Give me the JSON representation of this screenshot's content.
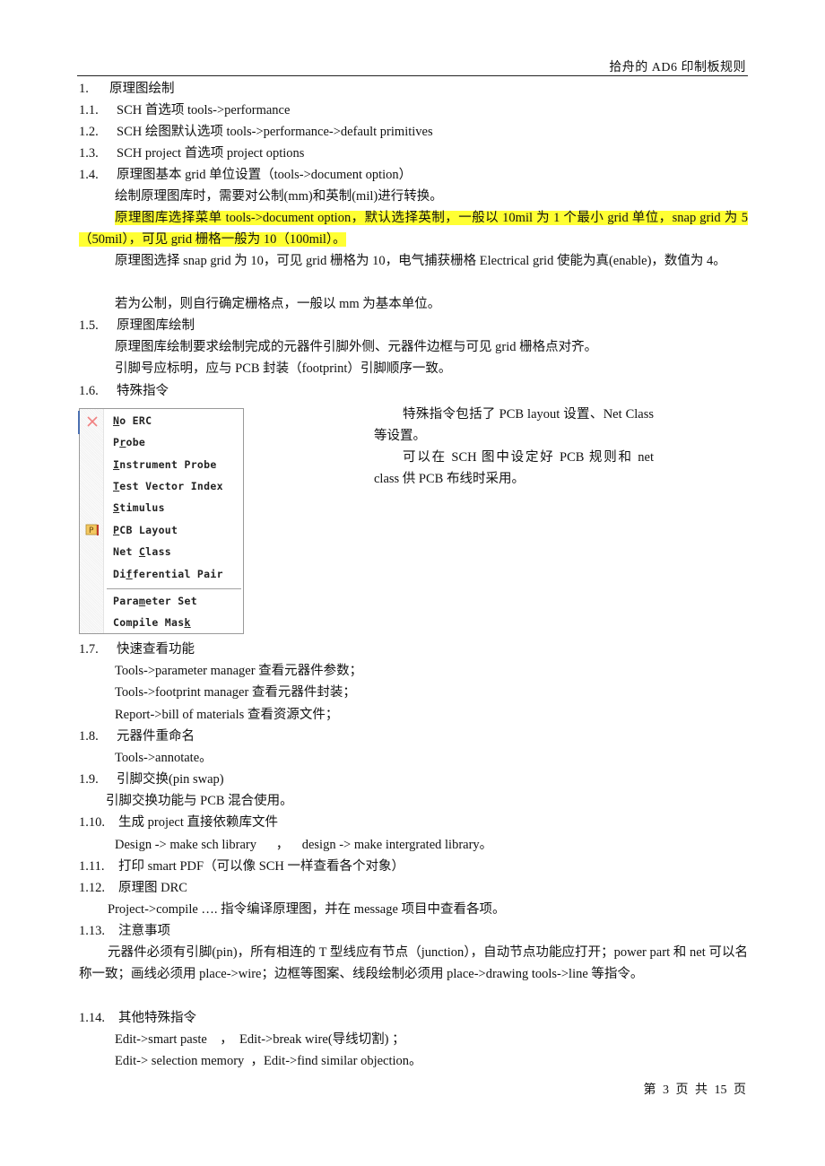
{
  "header": {
    "title": "拾舟的 AD6 印制板规则"
  },
  "sections": {
    "s1": {
      "num": "1.",
      "title": "原理图绘制"
    },
    "s1_1": {
      "num": "1.1.",
      "text": "SCH 首选项  tools->performance"
    },
    "s1_2": {
      "num": "1.2.",
      "text": "SCH 绘图默认选项 tools->performance->default primitives"
    },
    "s1_3": {
      "num": "1.3.",
      "text": "SCH project  首选项 project  options"
    },
    "s1_4": {
      "num": "1.4.",
      "text": "原理图基本 grid 单位设置（tools->document option）",
      "p1": "绘制原理图库时，需要对公制(mm)和英制(mil)进行转换。",
      "p2_highlight": "原理图库选择菜单 tools->document option，默认选择英制，一般以 10mil 为 1 个最小 grid 单位，snap grid 为 5（50mil），可见 grid 栅格一般为 10（100mil）。",
      "p3": "原理图选择 snap grid 为 10，可见 grid 栅格为 10，电气捕获栅格 Electrical grid 使能为真(enable)，数值为 4。",
      "p4": "若为公制，则自行确定栅格点，一般以 mm 为基本单位。"
    },
    "s1_5": {
      "num": "1.5.",
      "text": "原理图库绘制",
      "p1": "原理图库绘制要求绘制完成的元器件引脚外侧、元器件边框与可见 grid 栅格点对齐。",
      "p2": "引脚号应标明，应与 PCB 封装（footprint）引脚顺序一致。"
    },
    "s1_6": {
      "num": "1.6.",
      "text": "特殊指令",
      "side_p1": "特殊指令包括了 PCB layout 设置、Net Class 等设置。",
      "side_p2": "可以在 SCH 图中设定好 PCB 规则和 net class 供 PCB 布线时采用。"
    },
    "s1_7": {
      "num": "1.7.",
      "text": "快速查看功能",
      "l1": "Tools->parameter manager 查看元器件参数；",
      "l2": "Tools->footprint manager  查看元器件封装；",
      "l3": "Report->bill of materials 查看资源文件；"
    },
    "s1_8": {
      "num": "1.8.",
      "text": "元器件重命名",
      "l1": "Tools->annotate。"
    },
    "s1_9": {
      "num": "1.9.",
      "text": "引脚交换(pin swap)",
      "l1": "引脚交换功能与 PCB 混合使用。"
    },
    "s1_10": {
      "num": "1.10.",
      "text": "生成 project 直接依赖库文件",
      "l1": "Design -> make sch library      ，    design -> make intergrated library。"
    },
    "s1_11": {
      "num": "1.11.",
      "text": "打印 smart PDF（可以像 SCH 一样查看各个对象）"
    },
    "s1_12": {
      "num": "1.12.",
      "text": "原理图 DRC",
      "l1": "Project->compile ….  指令编译原理图，并在 message 项目中查看各项。"
    },
    "s1_13": {
      "num": "1.13.",
      "text": "注意事项",
      "p1": "元器件必须有引脚(pin)，所有相连的 T 型线应有节点（junction），自动节点功能应打开；power part 和 net 可以名称一致；画线必须用 place->wire；边框等图案、线段绘制必须用 place->drawing tools->line 等指令。"
    },
    "s1_14": {
      "num": "1.14.",
      "text": "其他特殊指令",
      "l1": "Edit->smart paste    ，  Edit->break wire(导线切割) ；",
      "l2": "Edit-> selection memory  ，Edit->find similar objection。"
    }
  },
  "context_menu": {
    "items": [
      {
        "pre": "",
        "u": "N",
        "post": "o ERC",
        "icon": "no-erc-x-icon"
      },
      {
        "pre": "P",
        "u": "r",
        "post": "obe",
        "icon": ""
      },
      {
        "pre": "",
        "u": "I",
        "post": "nstrument Probe",
        "icon": ""
      },
      {
        "pre": "",
        "u": "T",
        "post": "est Vector Index",
        "icon": ""
      },
      {
        "pre": "",
        "u": "S",
        "post": "timulus",
        "icon": ""
      },
      {
        "pre": "",
        "u": "P",
        "post": "CB Layout",
        "icon": "pcb-layout-directive-icon"
      },
      {
        "pre": "Net ",
        "u": "C",
        "post": "lass",
        "icon": ""
      },
      {
        "pre": "Di",
        "u": "f",
        "post": "ferential Pair",
        "icon": ""
      },
      {
        "pre": "Para",
        "u": "m",
        "post": "eter Set",
        "icon": ""
      },
      {
        "pre": "Compile Mas",
        "u": "k",
        "post": "",
        "icon": ""
      }
    ],
    "colors": {
      "x_icon": "#f08080",
      "pcb_icon_fill": "#f4c860",
      "pcb_icon_edge": "#c0392b"
    }
  },
  "footer": {
    "page_text": "第 3 页 共 15 页"
  },
  "colors": {
    "highlight": "#ffff33"
  }
}
